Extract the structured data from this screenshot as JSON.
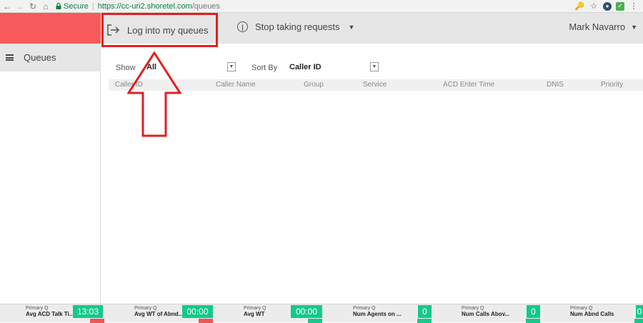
{
  "browser": {
    "secure_label": "Secure",
    "url_host": "https://cc-uri2.shoretel.com",
    "url_path": "/queues"
  },
  "header": {
    "login_label": "Log into my queues",
    "stop_label": "Stop taking requests",
    "user_name": "Mark Navarro"
  },
  "sidebar": {
    "items": [
      {
        "label": "Queues"
      }
    ]
  },
  "filters": {
    "show_label": "Show",
    "show_value": "All",
    "sort_label": "Sort By",
    "sort_value": "Caller ID"
  },
  "table": {
    "columns": [
      "Caller ID",
      "Caller Name",
      "Group",
      "Service",
      "ACD Enter Time",
      "DNIS",
      "Priority"
    ]
  },
  "stats": [
    {
      "caption": "Primary Q",
      "title": "Avg ACD Talk Ti...",
      "value": "13:03"
    },
    {
      "caption": "Primary Q",
      "title": "Avg WT of Abnd...",
      "value": "00:00"
    },
    {
      "caption": "Primary Q",
      "title": "Avg WT",
      "value": "00:00"
    },
    {
      "caption": "Primary Q",
      "title": "Num Agents on ...",
      "value": "0"
    },
    {
      "caption": "Primary Q",
      "title": "Num Calls Abov...",
      "value": "0"
    },
    {
      "caption": "Primary Q",
      "title": "Num Abnd Calls",
      "value": "0"
    }
  ],
  "colors": {
    "brand_red": "#f65a5a",
    "highlight_red": "#e02020",
    "stat_green": "#15c98b"
  }
}
